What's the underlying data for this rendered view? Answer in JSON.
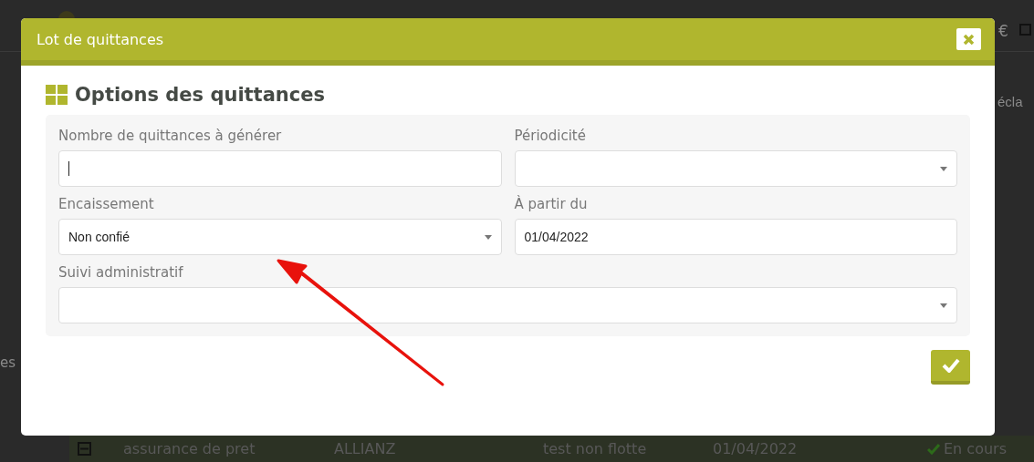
{
  "background": {
    "currency": "€",
    "tab_label": "écla",
    "side_label": "es",
    "row": {
      "expanded": true,
      "cells": [
        "assurance de pret",
        "ALLIANZ",
        "test non flotte",
        "01/04/2022"
      ],
      "status": "En cours"
    }
  },
  "dialog": {
    "title": "Lot de quittances",
    "section": "Options des quittances",
    "fields": [
      {
        "label": "Nombre de quittances à générer",
        "kind": "text",
        "focused": true
      },
      {
        "label": "Périodicité",
        "kind": "select"
      },
      {
        "label": "Encaissement",
        "kind": "select",
        "value": "Non confié"
      },
      {
        "label": "À partir du",
        "kind": "text",
        "value": "01/04/2022",
        "focused": false
      },
      {
        "label": "Suivi administratif",
        "kind": "select"
      }
    ]
  }
}
